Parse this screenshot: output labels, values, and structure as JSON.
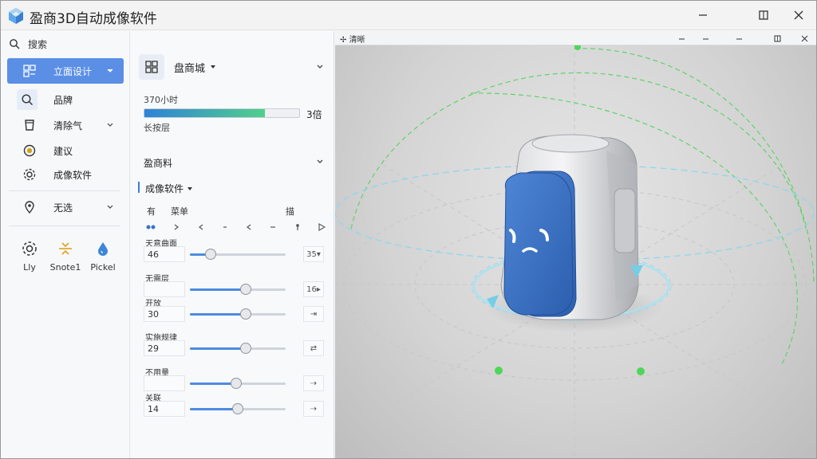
{
  "window": {
    "title": "盈商3D自动成像软件"
  },
  "sidebar": {
    "search_label": "搜索",
    "items": [
      {
        "label": "立面设计",
        "icon": "grid-icon",
        "active": true
      },
      {
        "label": "品牌",
        "icon": "search-icon"
      },
      {
        "label": "清除气",
        "icon": "cup-icon"
      },
      {
        "label": "建议",
        "icon": "coin-icon"
      },
      {
        "label": "成像软件",
        "icon": "gear-icon"
      },
      {
        "label": "无选",
        "icon": "location-pin-icon"
      }
    ],
    "tools": [
      {
        "label": "Lly",
        "icon": "gear-icon"
      },
      {
        "label": "Snote1",
        "icon": "split-icon"
      },
      {
        "label": "Pickel",
        "icon": "drop-icon"
      }
    ]
  },
  "panel": {
    "header_title": "盘商城",
    "progress_label": "370小时",
    "progress_value": 0.78,
    "progress_count": "3倍",
    "progress_sub": "长按层",
    "section1_title": "盈商料",
    "section2_title": "成像软件",
    "col_head_left": "有",
    "col_head_mid": "菜单",
    "col_head_right": "描",
    "sliders": [
      {
        "label": "天意曲面",
        "value": "46",
        "fraction": 0.22,
        "end": "35"
      },
      {
        "label": "无需层",
        "value": "",
        "fraction": 0.58,
        "end": "16"
      },
      {
        "label": "开放",
        "value": "30",
        "fraction": 0.58,
        "end": ""
      },
      {
        "label": "实施规律",
        "value": "29",
        "fraction": 0.58,
        "end": ""
      },
      {
        "label": "不用量",
        "value": "",
        "fraction": 0.48,
        "end": ""
      },
      {
        "label": "关联",
        "value": "14",
        "fraction": 0.5,
        "end": ""
      }
    ]
  },
  "viewport": {
    "title": "清晰",
    "accent": "#3d72c6"
  },
  "colors": {
    "accent": "#5b8fe6",
    "progress_start": "#2e83d8",
    "progress_end": "#4fd08a",
    "gizmo_green": "#4fd65a",
    "gizmo_cyan": "#7fd4ea"
  }
}
